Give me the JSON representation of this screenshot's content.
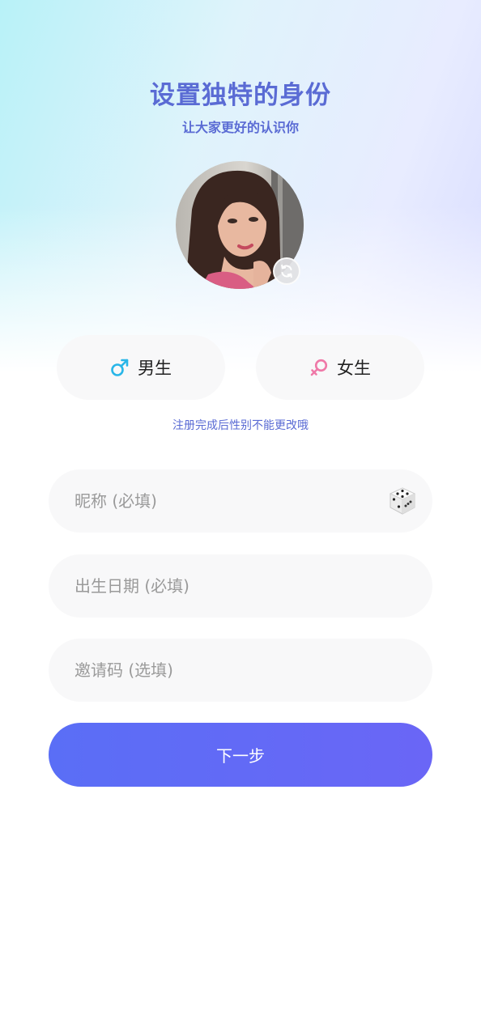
{
  "header": {
    "title": "设置独特的身份",
    "subtitle": "让大家更好的认识你"
  },
  "avatar": {
    "refresh_icon": "refresh-icon"
  },
  "gender": {
    "male_label": "男生",
    "female_label": "女生",
    "male_icon": "male-symbol-icon",
    "female_icon": "female-symbol-icon",
    "male_color": "#29b6e8",
    "female_color": "#ef79a8",
    "note": "注册完成后性别不能更改哦"
  },
  "form": {
    "nickname_placeholder": "昵称 (必填)",
    "nickname_value": "",
    "birthdate_placeholder": "出生日期 (必填)",
    "birthdate_value": "",
    "invite_placeholder": "邀请码 (选填)",
    "invite_value": "",
    "dice_icon": "dice-icon"
  },
  "actions": {
    "next_label": "下一步"
  },
  "colors": {
    "accent_text": "#5a6bd4",
    "button_gradient_start": "#5a6ef6",
    "button_gradient_end": "#6a66f6",
    "field_background": "#f8f8f9"
  }
}
